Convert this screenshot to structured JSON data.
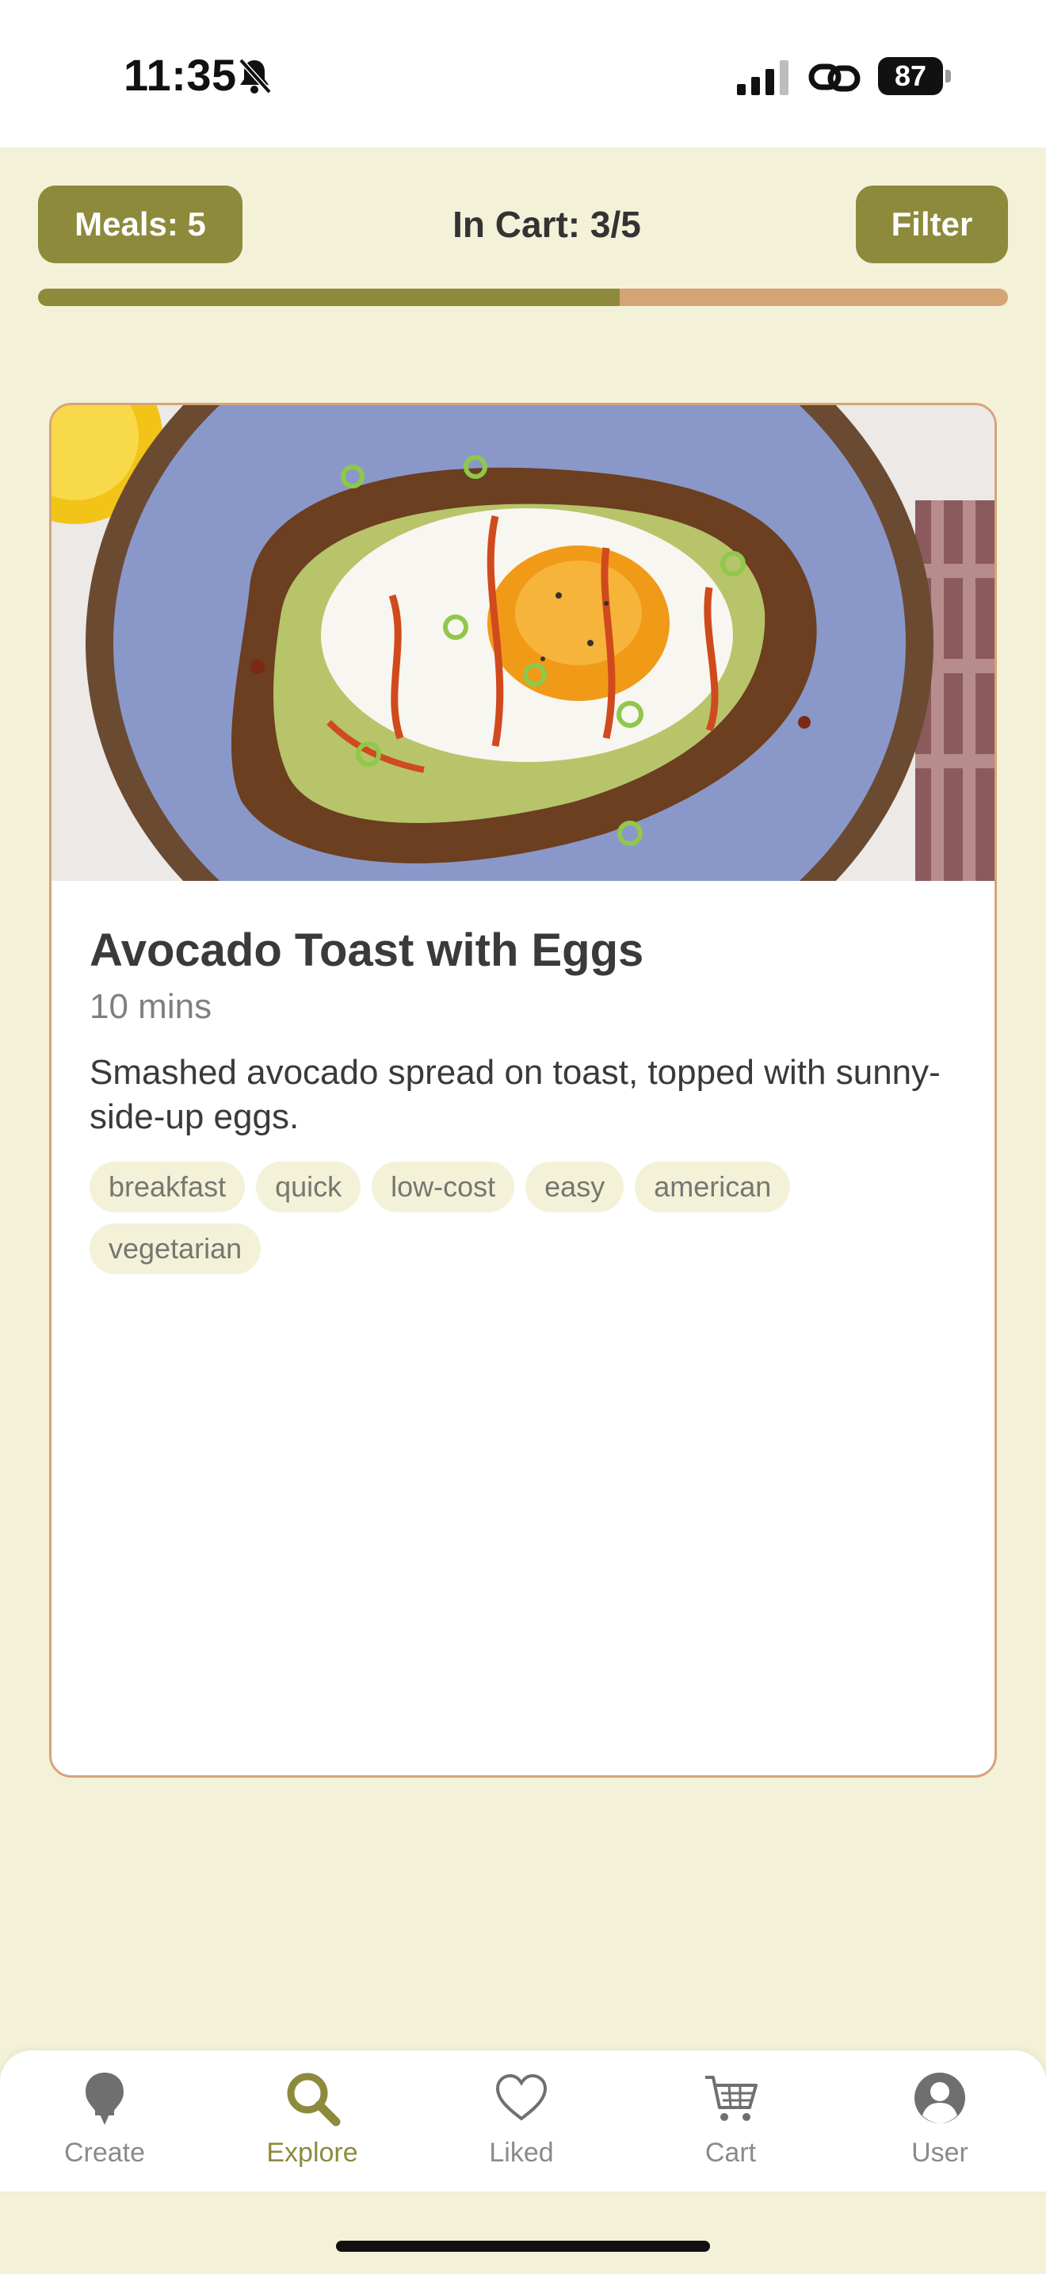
{
  "status_bar": {
    "time": "11:35",
    "battery": "87"
  },
  "header": {
    "meals_label": "Meals: 5",
    "cart_label": "In Cart: 3/5",
    "filter_label": "Filter",
    "progress_fraction": 0.6,
    "colors": {
      "accent": "#8d8a3c",
      "progress_remaining": "#d4a474",
      "background": "#f3f2d9"
    }
  },
  "meal": {
    "title": "Avocado Toast with Eggs",
    "time": "10 mins",
    "description": "Smashed avocado spread on toast, topped with sunny-side-up eggs.",
    "image_icon": "avocado-toast-photo",
    "tags": [
      "breakfast",
      "quick",
      "low-cost",
      "easy",
      "american",
      "vegetarian"
    ]
  },
  "tab_bar": {
    "tabs": [
      {
        "label": "Create",
        "icon": "lightbulb-icon",
        "active": false
      },
      {
        "label": "Explore",
        "icon": "search-icon",
        "active": true
      },
      {
        "label": "Liked",
        "icon": "heart-icon",
        "active": false
      },
      {
        "label": "Cart",
        "icon": "cart-icon",
        "active": false
      },
      {
        "label": "User",
        "icon": "user-icon",
        "active": false
      }
    ]
  }
}
